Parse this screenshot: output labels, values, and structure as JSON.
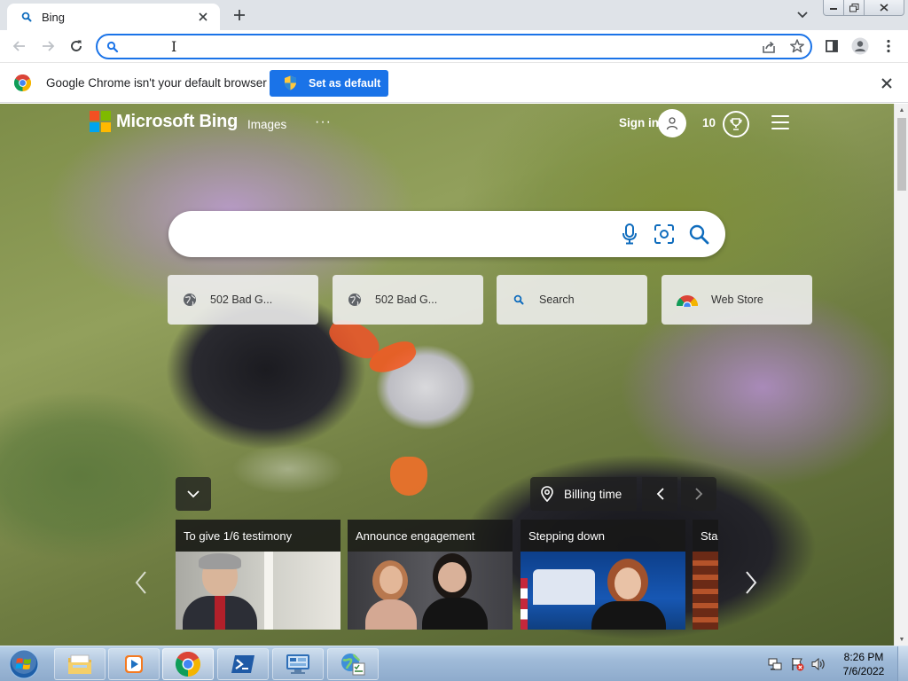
{
  "browser": {
    "tab": {
      "title": "Bing"
    },
    "omnibox": {
      "value": "",
      "placeholder": ""
    },
    "infobar": {
      "message": "Google Chrome isn't your default browser",
      "button_label": "Set as default"
    }
  },
  "bing": {
    "brand": "Microsoft Bing",
    "nav": {
      "images": "Images",
      "more": "···"
    },
    "header": {
      "sign_in": "Sign in",
      "points": "10"
    },
    "search": {
      "value": "",
      "placeholder": ""
    },
    "quick_links": [
      {
        "label": "502 Bad G...",
        "icon": "globe-icon"
      },
      {
        "label": "502 Bad G...",
        "icon": "globe-icon"
      },
      {
        "label": "Search",
        "icon": "search-icon"
      },
      {
        "label": "Web Store",
        "icon": "chrome-webstore-icon"
      }
    ],
    "location": "Billing time",
    "news": [
      {
        "headline": "To give 1/6 testimony"
      },
      {
        "headline": "Announce engagement"
      },
      {
        "headline": "Stepping down"
      },
      {
        "headline": "Star"
      }
    ]
  },
  "taskbar": {
    "apps": [
      "explorer-icon",
      "media-player-icon",
      "chrome-icon",
      "powershell-icon",
      "remote-desktop-icon",
      "network-tool-icon"
    ],
    "clock": {
      "time": "8:26 PM",
      "date": "7/6/2022"
    }
  },
  "colors": {
    "accent": "#1a73e8",
    "ms_red": "#f25022",
    "ms_green": "#7fba00",
    "ms_blue": "#00a4ef",
    "ms_yellow": "#ffb900",
    "bing_icon": "#0f6cbd"
  }
}
